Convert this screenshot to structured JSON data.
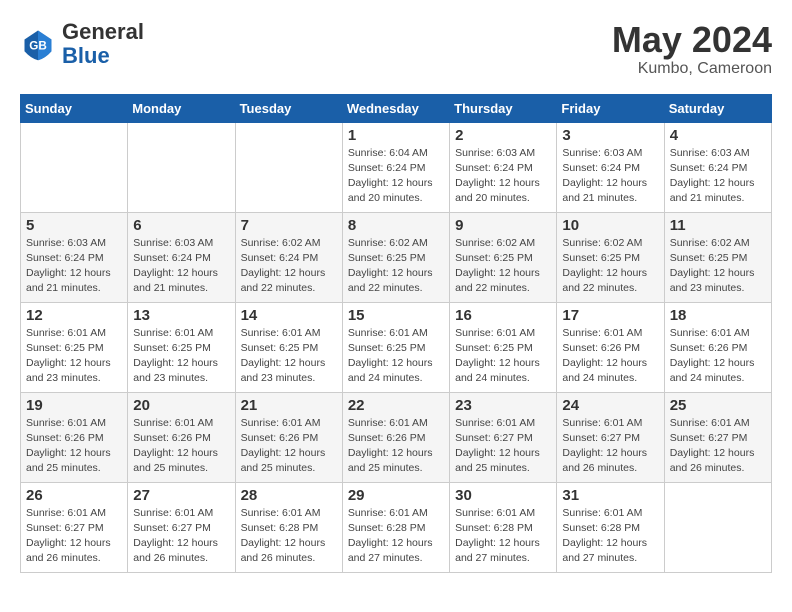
{
  "header": {
    "logo_line1": "General",
    "logo_line2": "Blue",
    "month": "May 2024",
    "location": "Kumbo, Cameroon"
  },
  "weekdays": [
    "Sunday",
    "Monday",
    "Tuesday",
    "Wednesday",
    "Thursday",
    "Friday",
    "Saturday"
  ],
  "weeks": [
    [
      {
        "day": "",
        "info": ""
      },
      {
        "day": "",
        "info": ""
      },
      {
        "day": "",
        "info": ""
      },
      {
        "day": "1",
        "info": "Sunrise: 6:04 AM\nSunset: 6:24 PM\nDaylight: 12 hours\nand 20 minutes."
      },
      {
        "day": "2",
        "info": "Sunrise: 6:03 AM\nSunset: 6:24 PM\nDaylight: 12 hours\nand 20 minutes."
      },
      {
        "day": "3",
        "info": "Sunrise: 6:03 AM\nSunset: 6:24 PM\nDaylight: 12 hours\nand 21 minutes."
      },
      {
        "day": "4",
        "info": "Sunrise: 6:03 AM\nSunset: 6:24 PM\nDaylight: 12 hours\nand 21 minutes."
      }
    ],
    [
      {
        "day": "5",
        "info": "Sunrise: 6:03 AM\nSunset: 6:24 PM\nDaylight: 12 hours\nand 21 minutes."
      },
      {
        "day": "6",
        "info": "Sunrise: 6:03 AM\nSunset: 6:24 PM\nDaylight: 12 hours\nand 21 minutes."
      },
      {
        "day": "7",
        "info": "Sunrise: 6:02 AM\nSunset: 6:24 PM\nDaylight: 12 hours\nand 22 minutes."
      },
      {
        "day": "8",
        "info": "Sunrise: 6:02 AM\nSunset: 6:25 PM\nDaylight: 12 hours\nand 22 minutes."
      },
      {
        "day": "9",
        "info": "Sunrise: 6:02 AM\nSunset: 6:25 PM\nDaylight: 12 hours\nand 22 minutes."
      },
      {
        "day": "10",
        "info": "Sunrise: 6:02 AM\nSunset: 6:25 PM\nDaylight: 12 hours\nand 22 minutes."
      },
      {
        "day": "11",
        "info": "Sunrise: 6:02 AM\nSunset: 6:25 PM\nDaylight: 12 hours\nand 23 minutes."
      }
    ],
    [
      {
        "day": "12",
        "info": "Sunrise: 6:01 AM\nSunset: 6:25 PM\nDaylight: 12 hours\nand 23 minutes."
      },
      {
        "day": "13",
        "info": "Sunrise: 6:01 AM\nSunset: 6:25 PM\nDaylight: 12 hours\nand 23 minutes."
      },
      {
        "day": "14",
        "info": "Sunrise: 6:01 AM\nSunset: 6:25 PM\nDaylight: 12 hours\nand 23 minutes."
      },
      {
        "day": "15",
        "info": "Sunrise: 6:01 AM\nSunset: 6:25 PM\nDaylight: 12 hours\nand 24 minutes."
      },
      {
        "day": "16",
        "info": "Sunrise: 6:01 AM\nSunset: 6:25 PM\nDaylight: 12 hours\nand 24 minutes."
      },
      {
        "day": "17",
        "info": "Sunrise: 6:01 AM\nSunset: 6:26 PM\nDaylight: 12 hours\nand 24 minutes."
      },
      {
        "day": "18",
        "info": "Sunrise: 6:01 AM\nSunset: 6:26 PM\nDaylight: 12 hours\nand 24 minutes."
      }
    ],
    [
      {
        "day": "19",
        "info": "Sunrise: 6:01 AM\nSunset: 6:26 PM\nDaylight: 12 hours\nand 25 minutes."
      },
      {
        "day": "20",
        "info": "Sunrise: 6:01 AM\nSunset: 6:26 PM\nDaylight: 12 hours\nand 25 minutes."
      },
      {
        "day": "21",
        "info": "Sunrise: 6:01 AM\nSunset: 6:26 PM\nDaylight: 12 hours\nand 25 minutes."
      },
      {
        "day": "22",
        "info": "Sunrise: 6:01 AM\nSunset: 6:26 PM\nDaylight: 12 hours\nand 25 minutes."
      },
      {
        "day": "23",
        "info": "Sunrise: 6:01 AM\nSunset: 6:27 PM\nDaylight: 12 hours\nand 25 minutes."
      },
      {
        "day": "24",
        "info": "Sunrise: 6:01 AM\nSunset: 6:27 PM\nDaylight: 12 hours\nand 26 minutes."
      },
      {
        "day": "25",
        "info": "Sunrise: 6:01 AM\nSunset: 6:27 PM\nDaylight: 12 hours\nand 26 minutes."
      }
    ],
    [
      {
        "day": "26",
        "info": "Sunrise: 6:01 AM\nSunset: 6:27 PM\nDaylight: 12 hours\nand 26 minutes."
      },
      {
        "day": "27",
        "info": "Sunrise: 6:01 AM\nSunset: 6:27 PM\nDaylight: 12 hours\nand 26 minutes."
      },
      {
        "day": "28",
        "info": "Sunrise: 6:01 AM\nSunset: 6:28 PM\nDaylight: 12 hours\nand 26 minutes."
      },
      {
        "day": "29",
        "info": "Sunrise: 6:01 AM\nSunset: 6:28 PM\nDaylight: 12 hours\nand 27 minutes."
      },
      {
        "day": "30",
        "info": "Sunrise: 6:01 AM\nSunset: 6:28 PM\nDaylight: 12 hours\nand 27 minutes."
      },
      {
        "day": "31",
        "info": "Sunrise: 6:01 AM\nSunset: 6:28 PM\nDaylight: 12 hours\nand 27 minutes."
      },
      {
        "day": "",
        "info": ""
      }
    ]
  ]
}
